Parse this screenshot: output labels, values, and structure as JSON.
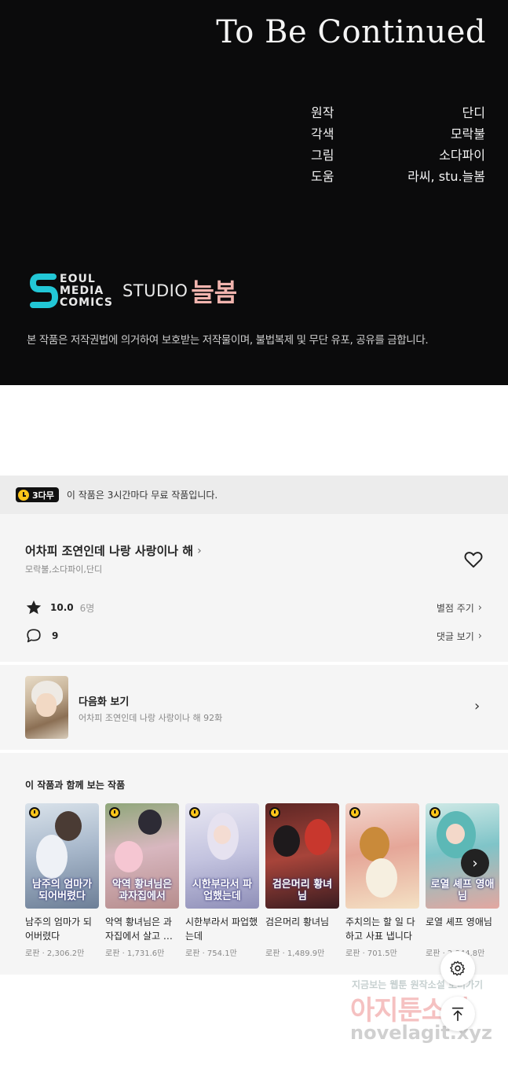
{
  "endcard": {
    "heading": "To Be Continued",
    "credits": [
      {
        "role": "원작",
        "name": "단디"
      },
      {
        "role": "각색",
        "name": "모락불"
      },
      {
        "role": "그림",
        "name": "소다파이"
      },
      {
        "role": "도움",
        "name": "라씨, stu.늘봄"
      }
    ],
    "logo_smc": [
      "EOUL",
      "MEDIA",
      "COMICS"
    ],
    "logo_studio": "STUDIO",
    "logo_neulbom": "늘봄",
    "notice": "본 작품은 저작권법에 의거하여 보호받는 저작물이며, 불법복제 및 무단 유포, 공유를 금합니다."
  },
  "free_banner": {
    "badge": "3다무",
    "text": "이 작품은 3시간마다 무료 작품입니다."
  },
  "info": {
    "title": "어차피 조연인데 나랑 사랑이나 해",
    "authors": "모락불,소다파이,단디",
    "score": "10.0",
    "rating_count": "6명",
    "rate_link": "별점 주기",
    "comments": "9",
    "comments_link": "댓글 보기"
  },
  "next": {
    "title": "다음화 보기",
    "subtitle": "어차피 조연인데 나랑 사랑이나 해 92화"
  },
  "related": {
    "heading": "이 작품과 함께 보는 작품",
    "items": [
      {
        "name": "남주의 엄마가 되어버렸다",
        "meta": "로판 · 2,306.2만",
        "cover_text": "남주의 엄마가 되어버렸다",
        "bg": "#9fb2c8"
      },
      {
        "name": "악역 황녀님은 과자집에서 살고 싶어",
        "meta": "로판 · 1,731.6만",
        "cover_text": "악역 황녀님은 과자집에서",
        "bg": "#c7a6b2"
      },
      {
        "name": "시한부라서 파업했는데",
        "meta": "로판 · 754.1만",
        "cover_text": "시한부라서 파업했는데",
        "bg": "#c9c6dc"
      },
      {
        "name": "검은머리 황녀님",
        "meta": "로판 · 1,489.9만",
        "cover_text": "검은머리 황녀님",
        "bg": "#8a3a33"
      },
      {
        "name": "주치의는 할 일 다 하고 사표 냅니다",
        "meta": "로판 · 701.5만",
        "cover_text": "",
        "bg": "#e6b7a8"
      },
      {
        "name": "로열 셰프 영애님",
        "meta": "로판 · 2,844.8만",
        "cover_text": "로열 셰프 영애님",
        "bg": "#7fc4c8"
      }
    ]
  },
  "watermark": {
    "line1": "지금보는 웹툰 원작소설 보러가기",
    "line2": "아지툰소설",
    "line3": "novelagit.xyz"
  }
}
